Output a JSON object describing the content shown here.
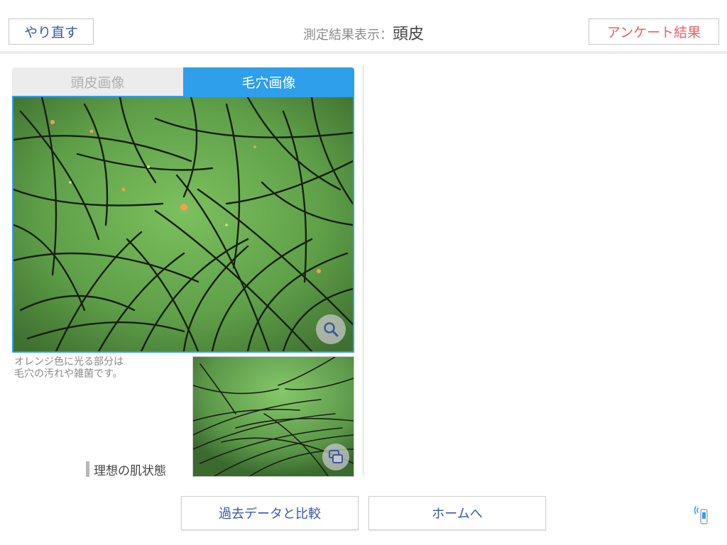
{
  "header": {
    "redo_label": "やり直す",
    "title_prefix": "測定結果表示：",
    "title_main": "頭皮",
    "survey_label": "アンケート結果"
  },
  "tabs": [
    {
      "label": "頭皮画像",
      "active": false
    },
    {
      "label": "毛穴画像",
      "active": true
    }
  ],
  "caption": {
    "line1": "オレンジ色に光る部分は",
    "line2": "毛穴の汚れや雑菌です。"
  },
  "ideal": {
    "label": "理想の肌状態"
  },
  "footer": {
    "compare_label": "過去データと比較",
    "home_label": "ホームへ"
  },
  "colors": {
    "accent": "#2e9fea",
    "button_text": "#3a58a8",
    "survey_text": "#e8606a"
  },
  "icons": {
    "zoom": "magnifier-icon",
    "swap": "image-swap-icon",
    "device": "device-signal-icon"
  }
}
